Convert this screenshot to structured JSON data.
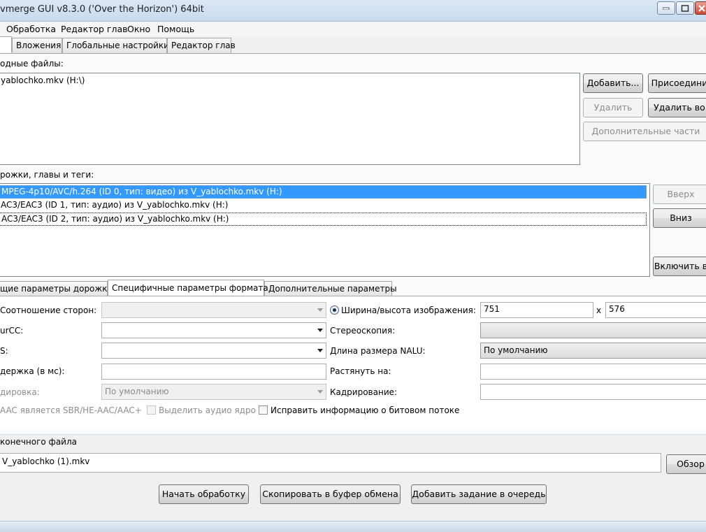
{
  "window": {
    "title": "vmerge GUI v8.3.0 ('Over the Horizon') 64bit"
  },
  "menu": [
    "Обработка",
    "Редактор глав",
    "Окно",
    "Помощь"
  ],
  "main_tabs": [
    "Вложения",
    "Глобальные настройки",
    "Редактор глав"
  ],
  "source": {
    "label": "одные файлы:",
    "files": [
      "yablochko.mkv (H:\\)"
    ],
    "buttons": {
      "add": "Добавить...",
      "append": "Присоедини",
      "remove": "Удалить",
      "remove_all": "Удалить во",
      "additional_parts": "Дополнительные части"
    }
  },
  "tracks": {
    "label": "рожки, главы и теги:",
    "items": [
      "MPEG-4p10/AVC/h.264 (ID 0, тип: видео) из V_yablochko.mkv (H:)",
      "AC3/EAC3 (ID 1, тип: аудио) из V_yablochko.mkv (H:)",
      "AC3/EAC3 (ID 2, тип: аудио) из V_yablochko.mkv (H:)"
    ],
    "buttons": {
      "up": "Вверх",
      "down": "Вниз",
      "enable": "Включить в"
    }
  },
  "props_tabs": [
    "щие параметры дорожки",
    "Специфичные параметры формата",
    "Дополнительные параметры"
  ],
  "props": {
    "aspect_label": "Соотношение сторон:",
    "fourcc_label": "urCC:",
    "fps_label": "S:",
    "delay_label": "держка (в мс):",
    "encoding_label": "дировка:",
    "encoding_value": "По умолчанию",
    "width_height_label": "Ширина/высота изображения:",
    "width_value": "751",
    "x_sep": "x",
    "height_value": "576",
    "stereo_label": "Стереоскопия:",
    "nalu_label": "Длина размера NALU:",
    "nalu_value": "По умолчанию",
    "stretch_label": "Растянуть на:",
    "crop_label": "Кадрирование:",
    "sbr_label": "AAC является SBR/HE-AAC/AAC+",
    "core_label": "Выделить аудио ядро",
    "fix_label": "Исправить информацию о битовом потоке"
  },
  "output": {
    "label": " конечного файла",
    "filename": "V_yablochko (1).mkv",
    "browse": "Обзор"
  },
  "actions": {
    "start": "Начать обработку",
    "copy": "Скопировать в буфер обмена",
    "queue": "Добавить задание в очередь"
  }
}
